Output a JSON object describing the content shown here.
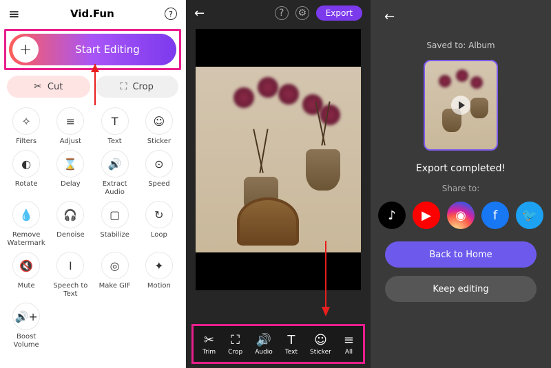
{
  "p1": {
    "title": "Vid.Fun",
    "start_label": "Start Editing",
    "cut_label": "Cut",
    "crop_label": "Crop",
    "tools": [
      {
        "icon": "✧",
        "label": "Filters"
      },
      {
        "icon": "≡",
        "label": "Adjust"
      },
      {
        "icon": "T",
        "label": "Text"
      },
      {
        "icon": "☺",
        "label": "Sticker"
      },
      {
        "icon": "◐",
        "label": "Rotate"
      },
      {
        "icon": "⌛",
        "label": "Delay"
      },
      {
        "icon": "🔊",
        "label": "Extract Audio"
      },
      {
        "icon": "⊙",
        "label": "Speed"
      },
      {
        "icon": "💧",
        "label": "Remove Watermark"
      },
      {
        "icon": "🎧",
        "label": "Denoise"
      },
      {
        "icon": "▢",
        "label": "Stabilize"
      },
      {
        "icon": "↻",
        "label": "Loop"
      },
      {
        "icon": "🔇",
        "label": "Mute"
      },
      {
        "icon": "I",
        "label": "Speech to Text"
      },
      {
        "icon": "◎",
        "label": "Make GIF"
      },
      {
        "icon": "✦",
        "label": "Motion"
      },
      {
        "icon": "🔊+",
        "label": "Boost Volume"
      }
    ]
  },
  "p2": {
    "export_label": "Export",
    "btm": [
      {
        "icon": "✂",
        "label": "Trim"
      },
      {
        "icon": "⛶",
        "label": "Crop"
      },
      {
        "icon": "🔊",
        "label": "Audio"
      },
      {
        "icon": "T",
        "label": "Text"
      },
      {
        "icon": "☺",
        "label": "Sticker"
      },
      {
        "icon": "≡",
        "label": "All"
      }
    ]
  },
  "p3": {
    "saved_to": "Saved to: Album",
    "exported": "Export completed!",
    "share_to": "Share to:",
    "back_home": "Back to Home",
    "keep_editing": "Keep editing",
    "socials": [
      {
        "name": "tiktok",
        "glyph": "♪"
      },
      {
        "name": "youtube",
        "glyph": "▶"
      },
      {
        "name": "instagram",
        "glyph": "◉"
      },
      {
        "name": "facebook",
        "glyph": "f"
      },
      {
        "name": "twitter",
        "glyph": "🐦"
      }
    ]
  }
}
